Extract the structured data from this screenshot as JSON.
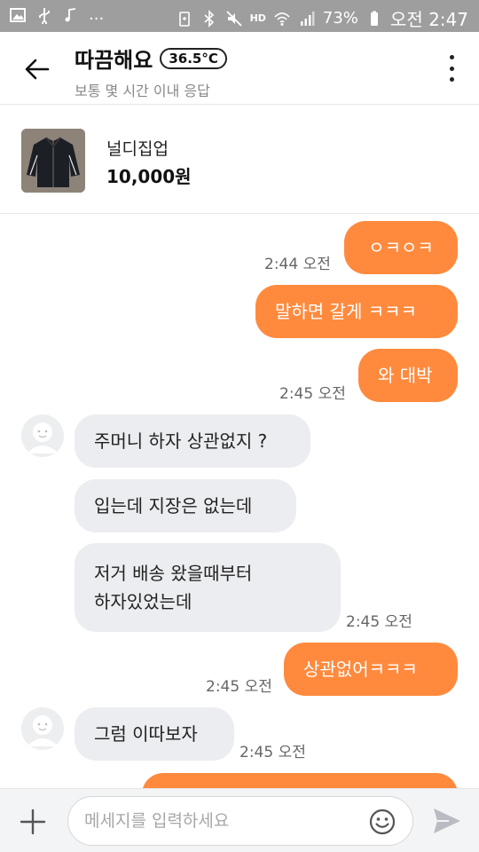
{
  "status_bar": {
    "left_icons": [
      "image-icon",
      "usb-icon",
      "music-note-icon"
    ],
    "ellipsis": "...",
    "battery_percent": "73%",
    "time": "오전 2:47",
    "hd_label": "HD"
  },
  "header": {
    "title": "따끔해요",
    "temperature": "36.5°C",
    "subtitle": "보통 몇 시간 이내 응답"
  },
  "product": {
    "name": "널디집업",
    "price": "10,000원"
  },
  "messages": [
    {
      "side": "out",
      "text": "ㅇㅋㅇㅋ",
      "time": "2:44 오전"
    },
    {
      "side": "out",
      "text": "말하면 갈게 ㅋㅋㅋ",
      "time": ""
    },
    {
      "side": "out",
      "text": "와 대박",
      "time": "2:45 오전"
    },
    {
      "side": "in",
      "text": "주머니 하자 상관없지 ?",
      "time": ""
    },
    {
      "side": "in",
      "text": "입는데 지장은 없는데",
      "time": ""
    },
    {
      "side": "in",
      "text_lines": [
        "저거 배송 왔을때부터",
        "하자있었는데"
      ],
      "time": "2:45 오전"
    },
    {
      "side": "out",
      "text": "상관없어ㅋㅋㅋ",
      "time": "2:45 오전"
    },
    {
      "side": "in",
      "text": "그럼 이따보자",
      "time": "2:45 오전"
    }
  ],
  "input": {
    "placeholder": "메세지를 입력하세요"
  },
  "colors": {
    "accent": "#ff8a3d",
    "incoming_bubble": "#ecedf0",
    "status_bar": "#9e9e9e"
  }
}
